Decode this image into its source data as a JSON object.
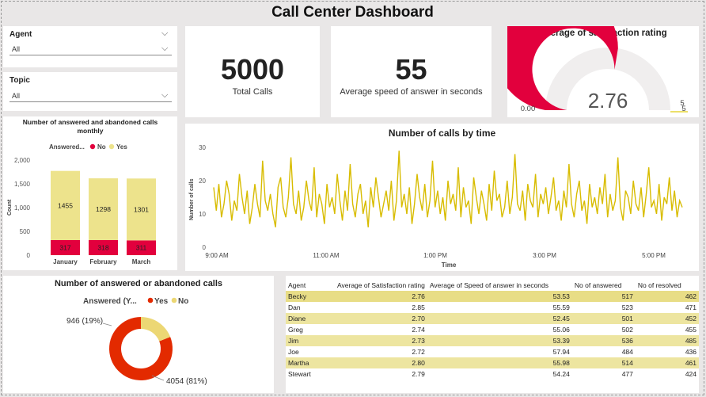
{
  "dashboard": {
    "title": "Call Center Dashboard"
  },
  "slicers": {
    "agent": {
      "label": "Agent",
      "value": "All"
    },
    "topic": {
      "label": "Topic",
      "value": "All"
    }
  },
  "kpis": {
    "total_calls": {
      "value": "5000",
      "label": "Total Calls"
    },
    "avg_speed": {
      "value": "55",
      "label": "Average speed of answer in seconds"
    }
  },
  "gauge": {
    "title": "Average of satisfaction rating",
    "value": 2.76,
    "value_label": "2.76",
    "min_label": "0.00",
    "max_label": "5",
    "target_label": "5",
    "min": 0,
    "max": 5,
    "fill_color": "#e2003d",
    "track_color": "#f0eeee"
  },
  "monthly_chart": {
    "title": "Number of answered and abandoned calls monthly",
    "legend_title": "Answered...",
    "ylabel": "Count",
    "ticks": [
      "0",
      "500",
      "1,000",
      "1,500",
      "2,000"
    ],
    "chart_data": {
      "type": "bar",
      "stacked": true,
      "categories": [
        "January",
        "February",
        "March"
      ],
      "series": [
        {
          "name": "No",
          "values": [
            317,
            318,
            311
          ],
          "color": "#e2003d"
        },
        {
          "name": "Yes",
          "values": [
            1455,
            1298,
            1301
          ],
          "color": "#ede38c"
        }
      ],
      "ylim": [
        0,
        2000
      ]
    }
  },
  "time_chart": {
    "title": "Number of calls by time",
    "xlabel": "Time",
    "ylabel": "Number of calls",
    "y_ticks": [
      "0",
      "10",
      "20",
      "30"
    ],
    "x_ticks": [
      "9:00 AM",
      "11:00 AM",
      "1:00 PM",
      "3:00 PM",
      "5:00 PM"
    ],
    "chart_data": {
      "type": "line",
      "color": "#d8bc00",
      "x_start": "9:00 AM",
      "x_end": "5:30 PM",
      "ylim": [
        0,
        30
      ],
      "values": [
        18,
        11,
        19,
        9,
        13,
        20,
        16,
        8,
        14,
        11,
        22,
        15,
        10,
        17,
        7,
        12,
        19,
        13,
        9,
        26,
        14,
        11,
        16,
        10,
        6,
        18,
        21,
        12,
        9,
        15,
        27,
        13,
        10,
        17,
        8,
        12,
        20,
        14,
        11,
        24,
        9,
        16,
        13,
        7,
        19,
        12,
        15,
        10,
        22,
        14,
        8,
        17,
        11,
        25,
        13,
        9,
        16,
        19,
        10,
        14,
        6,
        18,
        12,
        21,
        15,
        9,
        13,
        17,
        11,
        20,
        8,
        14,
        29,
        12,
        16,
        10,
        18,
        7,
        13,
        22,
        15,
        11,
        19,
        9,
        14,
        26,
        12,
        17,
        10,
        15,
        8,
        20,
        13,
        16,
        11,
        24,
        9,
        18,
        12,
        14,
        7,
        21,
        15,
        10,
        17,
        13,
        8,
        19,
        11,
        23,
        14,
        16,
        9,
        12,
        20,
        10,
        15,
        28,
        13,
        11,
        17,
        8,
        19,
        14,
        12,
        22,
        9,
        16,
        13,
        18,
        10,
        15,
        21,
        11,
        14,
        8,
        17,
        12,
        25,
        13,
        9,
        16,
        20,
        11,
        14,
        7,
        19,
        12,
        15,
        10,
        18,
        13,
        22,
        9,
        16,
        11,
        14,
        27,
        12,
        8,
        17,
        15,
        10,
        20,
        13,
        11,
        18,
        9,
        16,
        24,
        12,
        14,
        10,
        19,
        8,
        15,
        13,
        21,
        11,
        17,
        9,
        14,
        12
      ]
    }
  },
  "donut": {
    "title": "Number of answered or abandoned calls",
    "legend_title": "Answered (Y...",
    "chart_data": {
      "type": "pie",
      "donut": true,
      "slices": [
        {
          "name": "Yes",
          "value": 4054,
          "percent": 81,
          "label": "4054 (81%)",
          "color": "#e32a00"
        },
        {
          "name": "No",
          "value": 946,
          "percent": 19,
          "label": "946 (19%)",
          "color": "#ecd774"
        }
      ]
    }
  },
  "agent_table": {
    "columns": [
      "Agent",
      "Average of Satisfaction rating",
      "Average of Speed of answer in seconds",
      "No of answered",
      "No of resolved"
    ],
    "rows": [
      {
        "agent": "Becky",
        "satisfaction": "2.76",
        "speed": "53.53",
        "answered": "517",
        "resolved": "462"
      },
      {
        "agent": "Dan",
        "satisfaction": "2.85",
        "speed": "55.59",
        "answered": "523",
        "resolved": "471"
      },
      {
        "agent": "Diane",
        "satisfaction": "2.70",
        "speed": "52.45",
        "answered": "501",
        "resolved": "452"
      },
      {
        "agent": "Greg",
        "satisfaction": "2.74",
        "speed": "55.06",
        "answered": "502",
        "resolved": "455"
      },
      {
        "agent": "Jim",
        "satisfaction": "2.73",
        "speed": "53.39",
        "answered": "536",
        "resolved": "485"
      },
      {
        "agent": "Joe",
        "satisfaction": "2.72",
        "speed": "57.94",
        "answered": "484",
        "resolved": "436"
      },
      {
        "agent": "Martha",
        "satisfaction": "2.80",
        "speed": "55.98",
        "answered": "514",
        "resolved": "461"
      },
      {
        "agent": "Stewart",
        "satisfaction": "2.79",
        "speed": "54.24",
        "answered": "477",
        "resolved": "424"
      }
    ]
  }
}
